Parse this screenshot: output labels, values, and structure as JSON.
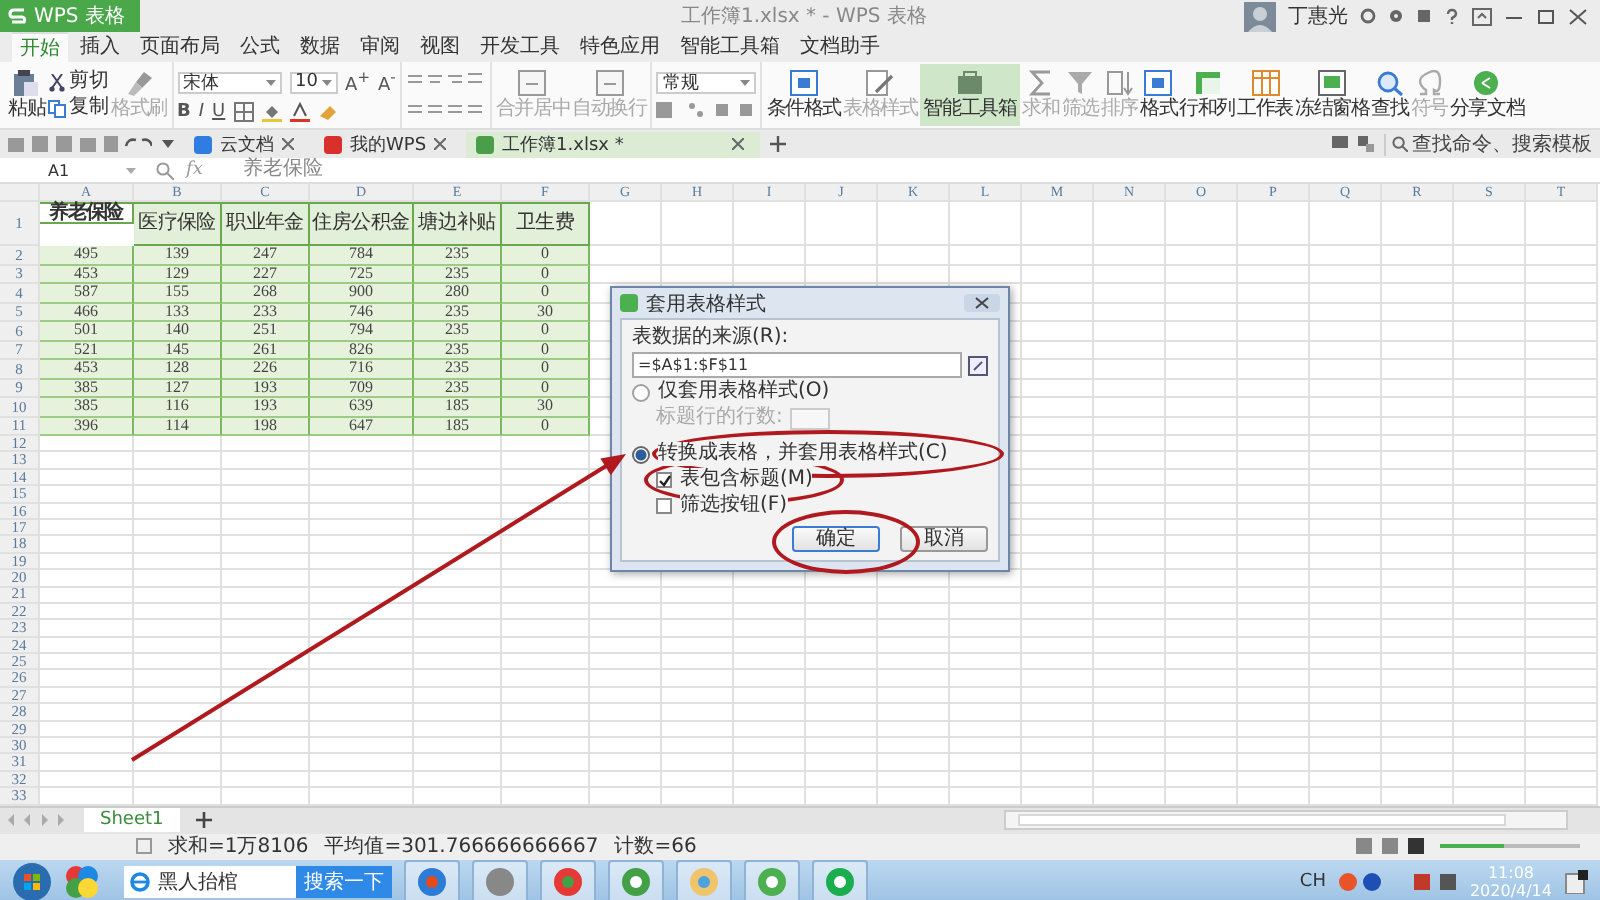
{
  "app": {
    "logo": "WPS 表格",
    "title": "工作簿1.xlsx * - WPS 表格",
    "user": "丁惠光"
  },
  "menu_tabs": [
    {
      "label": "开始",
      "selected": true
    },
    {
      "label": "插入",
      "selected": false
    },
    {
      "label": "页面布局",
      "selected": false
    },
    {
      "label": "公式",
      "selected": false
    },
    {
      "label": "数据",
      "selected": false
    },
    {
      "label": "审阅",
      "selected": false
    },
    {
      "label": "视图",
      "selected": false
    },
    {
      "label": "开发工具",
      "selected": false
    },
    {
      "label": "特色应用",
      "selected": false
    },
    {
      "label": "智能工具箱",
      "selected": false
    },
    {
      "label": "文档助手",
      "selected": false
    }
  ],
  "ribbon": {
    "paste": "粘贴",
    "cut": "剪切",
    "copy": "复制",
    "painter": "格式刷",
    "font_family": "宋体",
    "font_size": "10",
    "font_grow": "A$^{+}$",
    "font_shrink": "A$^{-}$",
    "styles": [
      "B",
      "I",
      "U"
    ],
    "align_buttons": [
      {
        "label": "合并居中",
        "disabled": true
      },
      {
        "label": "自动换行",
        "disabled": true
      }
    ],
    "number_format": "常规",
    "buttons": [
      {
        "label": "条件格式",
        "disabled": false,
        "selected": false
      },
      {
        "label": "表格样式",
        "disabled": true,
        "selected": false
      },
      {
        "label": "智能工具箱",
        "disabled": false,
        "selected": true
      },
      {
        "label": "求和",
        "disabled": true,
        "selected": false
      },
      {
        "label": "筛选",
        "disabled": true,
        "selected": false
      },
      {
        "label": "排序",
        "disabled": true,
        "selected": false
      },
      {
        "label": "格式",
        "disabled": false,
        "selected": false
      },
      {
        "label": "行和列",
        "disabled": false,
        "selected": false
      },
      {
        "label": "工作表",
        "disabled": false,
        "selected": false
      },
      {
        "label": "冻结窗格",
        "disabled": false,
        "selected": false
      },
      {
        "label": "查找",
        "disabled": false,
        "selected": false
      },
      {
        "label": "符号",
        "disabled": true,
        "selected": false
      },
      {
        "label": "分享文档",
        "disabled": false,
        "selected": false
      }
    ]
  },
  "doc_tabs": [
    {
      "label": "云文档",
      "selected": false
    },
    {
      "label": "我的WPS",
      "selected": false
    },
    {
      "label": "工作簿1.xlsx *",
      "selected": true
    }
  ],
  "search_command": {
    "placeholder": "查找命令、搜索模板"
  },
  "formula_bar": {
    "cell": "A1",
    "fx": "fx",
    "value": "养老保险"
  },
  "sheet": {
    "columns": [
      "A",
      "B",
      "C",
      "D",
      "E",
      "F",
      "G",
      "H",
      "I",
      "J",
      "K",
      "L",
      "M",
      "N",
      "O",
      "P",
      "Q",
      "R",
      "S",
      "T"
    ],
    "row_numbers": [
      "1",
      "2",
      "3",
      "4",
      "5",
      "6",
      "7",
      "8",
      "9",
      "10",
      "11",
      "12",
      "13",
      "14",
      "15",
      "16",
      "17",
      "18",
      "19",
      "20",
      "21",
      "22",
      "23",
      "24",
      "25",
      "26",
      "27",
      "28",
      "29",
      "30",
      "31",
      "32",
      "33"
    ],
    "header": [
      {
        "text": "养老保险",
        "selected": true
      },
      {
        "text": "医疗保险",
        "selected": false
      },
      {
        "text": "职业年金",
        "selected": false
      },
      {
        "text": "住房公积金",
        "selected": false
      },
      {
        "text": "塘边补贴",
        "selected": false
      },
      {
        "text": "卫生费",
        "selected": false
      }
    ],
    "rows": [
      [
        "495",
        "139",
        "247",
        "784",
        "235",
        "0"
      ],
      [
        "453",
        "129",
        "227",
        "725",
        "235",
        "0"
      ],
      [
        "587",
        "155",
        "268",
        "900",
        "280",
        "0"
      ],
      [
        "466",
        "133",
        "233",
        "746",
        "235",
        "30"
      ],
      [
        "501",
        "140",
        "251",
        "794",
        "235",
        "0"
      ],
      [
        "521",
        "145",
        "261",
        "826",
        "235",
        "0"
      ],
      [
        "453",
        "128",
        "226",
        "716",
        "235",
        "0"
      ],
      [
        "385",
        "127",
        "193",
        "709",
        "235",
        "0"
      ],
      [
        "385",
        "116",
        "193",
        "639",
        "185",
        "30"
      ],
      [
        "396",
        "114",
        "198",
        "647",
        "185",
        "0"
      ]
    ]
  },
  "dialog": {
    "title": "套用表格样式",
    "source_label": "表数据的来源(R):",
    "source_value": "=$A$1:$F$11",
    "options": [
      {
        "label": "仅套用表格样式(O)",
        "selected": false
      },
      {
        "label": "转换成表格，并套用表格样式(C)",
        "selected": true
      }
    ],
    "header_rows": {
      "label": "标题行的行数:",
      "disabled": true
    },
    "checks": [
      {
        "label": "表包含标题(M)",
        "checked": true
      },
      {
        "label": "筛选按钮(F)",
        "checked": false
      }
    ],
    "buttons": [
      "确定",
      "取消"
    ]
  },
  "sheet_tabs": [
    {
      "label": "Sheet1",
      "selected": true
    }
  ],
  "status": {
    "sum": "求和=1万8106",
    "average": "平均值=301.766666666667",
    "count": "计数=66",
    "zoom": {
      "level": 0.45
    }
  },
  "taskbar": {
    "search": {
      "value": "黑人抬棺"
    },
    "search_button": "搜索一下",
    "ime": "CH",
    "time": "11:08",
    "date": "2020/4/14"
  }
}
